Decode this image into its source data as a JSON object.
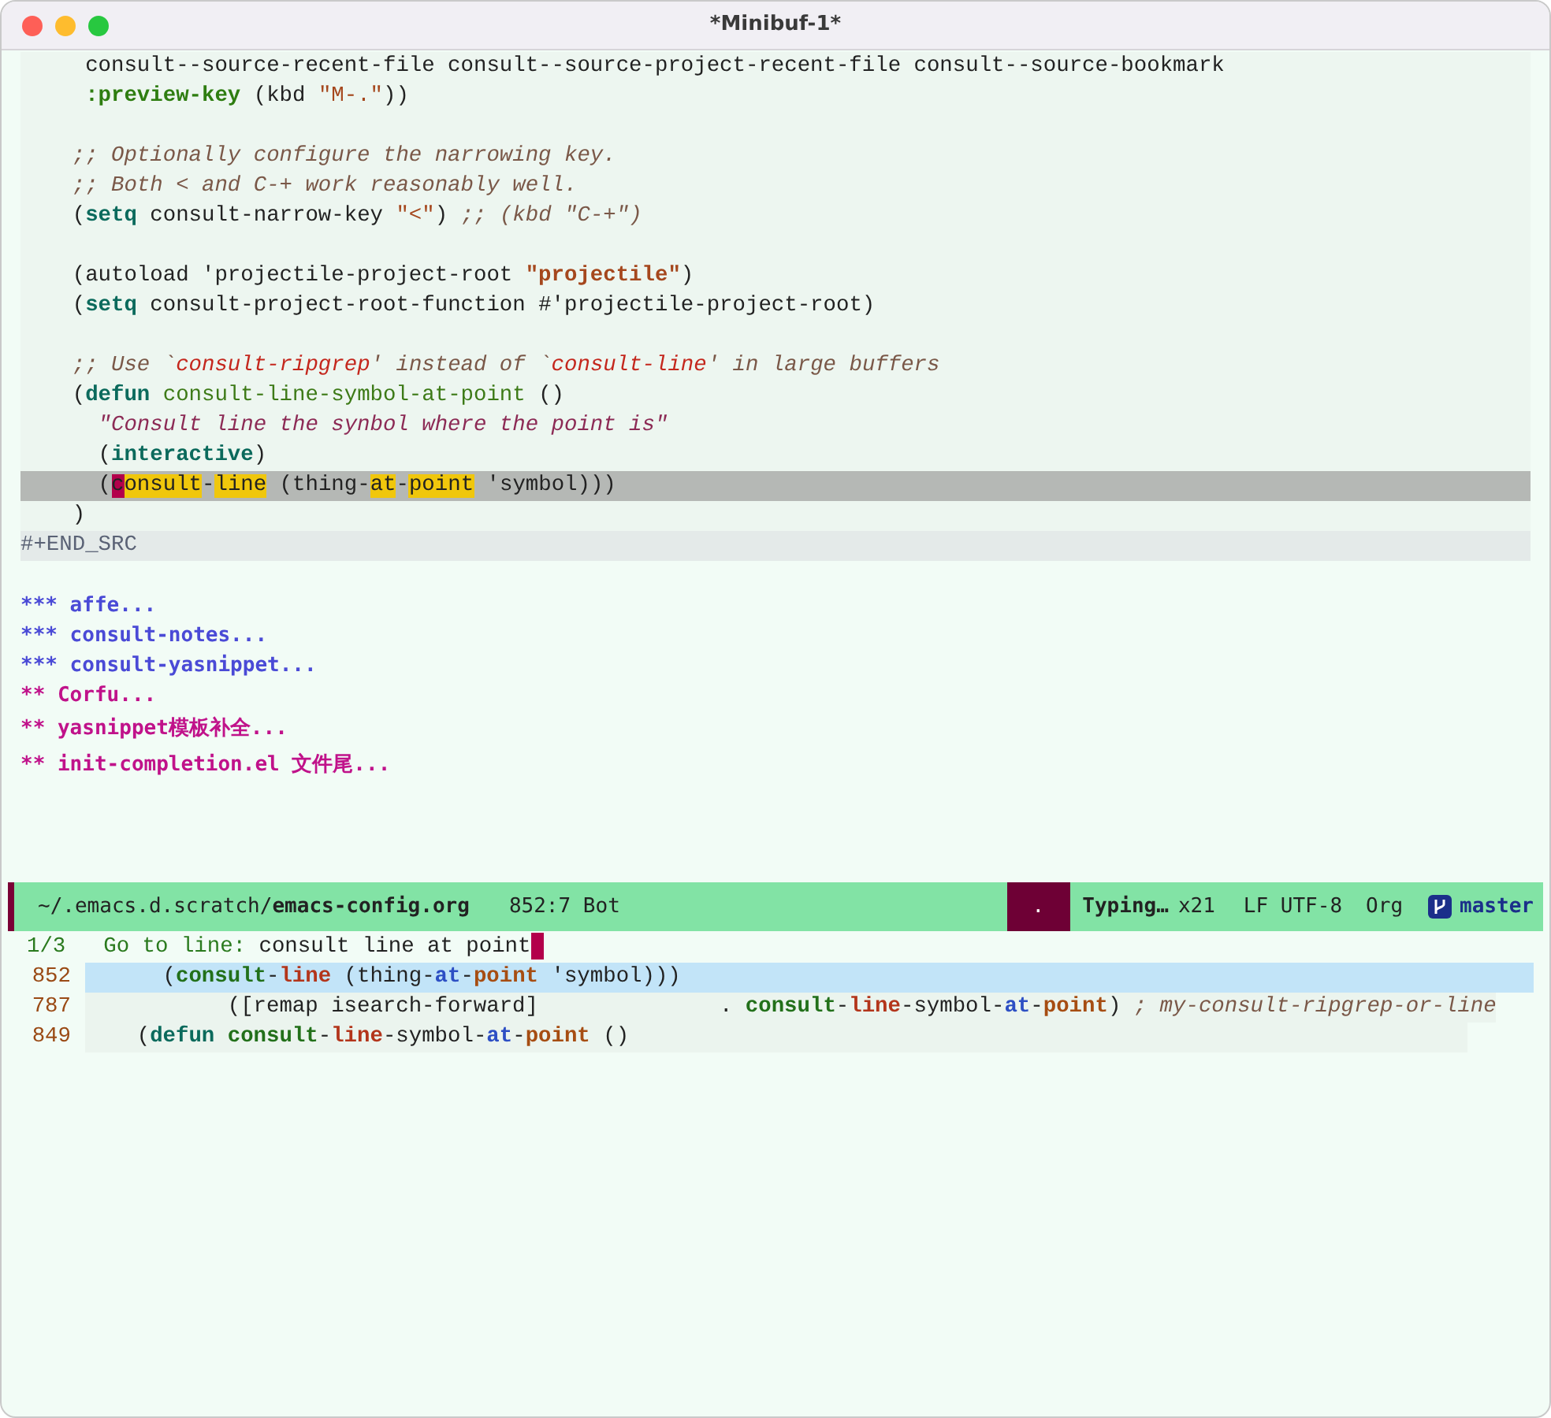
{
  "window": {
    "title": "*Minibuf-1*"
  },
  "buffer": {
    "lines": [
      {
        "kind": "src",
        "segments": [
          {
            "text": "     consult--source-recent-file consult--source-project-recent-file consult--source-bookmark",
            "kind": "plain"
          }
        ]
      },
      {
        "kind": "src",
        "segments": [
          {
            "text": "     :preview-key",
            "kind": "builtin"
          },
          {
            "text": " (kbd ",
            "kind": "plain"
          },
          {
            "text": "\"M-.\"",
            "kind": "str"
          },
          {
            "text": "))",
            "kind": "plain"
          }
        ]
      },
      {
        "kind": "src-blank"
      },
      {
        "kind": "src",
        "segments": [
          {
            "text": "    ;; Optionally configure the narrowing key.",
            "kind": "comment"
          }
        ]
      },
      {
        "kind": "src",
        "segments": [
          {
            "text": "    ;; Both < and C-+ work reasonably well.",
            "kind": "comment"
          }
        ]
      },
      {
        "kind": "src",
        "segments": [
          {
            "text": "    (",
            "kind": "plain"
          },
          {
            "text": "setq",
            "kind": "keyword"
          },
          {
            "text": " consult-narrow-key ",
            "kind": "plain"
          },
          {
            "text": "\"<\"",
            "kind": "str"
          },
          {
            "text": ") ",
            "kind": "plain"
          },
          {
            "text": ";; (kbd \"C-+\")",
            "kind": "comment"
          }
        ]
      },
      {
        "kind": "src-blank"
      },
      {
        "kind": "src",
        "segments": [
          {
            "text": "    (autoload 'projectile-project-root ",
            "kind": "plain"
          },
          {
            "text": "\"projectile\"",
            "kind": "str-bold"
          },
          {
            "text": ")",
            "kind": "plain"
          }
        ]
      },
      {
        "kind": "src",
        "segments": [
          {
            "text": "    (",
            "kind": "plain"
          },
          {
            "text": "setq",
            "kind": "keyword"
          },
          {
            "text": " consult-project-root-function #'projectile-project-root)",
            "kind": "plain"
          }
        ]
      },
      {
        "kind": "src-blank"
      },
      {
        "kind": "src",
        "segments": [
          {
            "text": "    ;; Use `",
            "kind": "comment"
          },
          {
            "text": "consult-ripgrep",
            "kind": "comment-ref"
          },
          {
            "text": "' instead of `",
            "kind": "comment"
          },
          {
            "text": "consult-line",
            "kind": "comment-ref"
          },
          {
            "text": "' in large buffers",
            "kind": "comment"
          }
        ]
      },
      {
        "kind": "src",
        "segments": [
          {
            "text": "    (",
            "kind": "plain"
          },
          {
            "text": "defun",
            "kind": "keyword"
          },
          {
            "text": " consult-line-symbol-at-point",
            "kind": "function"
          },
          {
            "text": " ()",
            "kind": "plain"
          }
        ]
      },
      {
        "kind": "src",
        "segments": [
          {
            "text": "      \"Consult line the synbol where the point is\"",
            "kind": "doc"
          }
        ]
      },
      {
        "kind": "src",
        "segments": [
          {
            "text": "      (",
            "kind": "plain"
          },
          {
            "text": "interactive",
            "kind": "keyword"
          },
          {
            "text": ")",
            "kind": "plain"
          }
        ]
      },
      {
        "kind": "current",
        "segments": [
          {
            "text": "      (",
            "kind": "plain"
          },
          {
            "text": "c",
            "kind": "cursor"
          },
          {
            "text": "onsult",
            "kind": "match"
          },
          {
            "text": "-",
            "kind": "plain"
          },
          {
            "text": "line",
            "kind": "match"
          },
          {
            "text": " (thing-",
            "kind": "plain"
          },
          {
            "text": "at",
            "kind": "match"
          },
          {
            "text": "-",
            "kind": "plain"
          },
          {
            "text": "point",
            "kind": "match"
          },
          {
            "text": " 'symbol)))",
            "kind": "plain"
          }
        ]
      },
      {
        "kind": "src",
        "segments": [
          {
            "text": "    )",
            "kind": "plain"
          }
        ]
      },
      {
        "kind": "src-end",
        "segments": [
          {
            "text": "#+END_SRC",
            "kind": "meta"
          }
        ]
      },
      {
        "kind": "blank"
      },
      {
        "kind": "heading",
        "segments": [
          {
            "text": "*** affe...",
            "kind": "h3"
          }
        ]
      },
      {
        "kind": "heading",
        "segments": [
          {
            "text": "*** consult-notes...",
            "kind": "h3"
          }
        ]
      },
      {
        "kind": "heading",
        "segments": [
          {
            "text": "*** consult-yasnippet...",
            "kind": "h3"
          }
        ]
      },
      {
        "kind": "heading",
        "segments": [
          {
            "text": "** Corfu...",
            "kind": "h2"
          }
        ]
      },
      {
        "kind": "heading",
        "segments": [
          {
            "text": "** yasnippet模板补全...",
            "kind": "h2"
          }
        ]
      },
      {
        "kind": "heading",
        "segments": [
          {
            "text": "** init-completion.el 文件尾...",
            "kind": "h2"
          }
        ]
      }
    ]
  },
  "mode_line": {
    "path": "~/.emacs.d.scratch/",
    "file": "emacs-config.org",
    "position": "852:7 Bot",
    "indicator": ".",
    "state": "Typing…",
    "count": "x21",
    "encoding": "LF UTF-8",
    "mode": "Org",
    "branch": "master"
  },
  "minibuffer": {
    "count": "1/3",
    "prompt": "Go to line: ",
    "input": "consult line at point",
    "candidates": [
      {
        "line_number": "852",
        "selected": true,
        "segments": [
          {
            "text": "      (",
            "kind": "plain"
          },
          {
            "text": "consult",
            "kind": "m1"
          },
          {
            "text": "-",
            "kind": "plain"
          },
          {
            "text": "line",
            "kind": "m2"
          },
          {
            "text": " (thing-",
            "kind": "plain"
          },
          {
            "text": "at",
            "kind": "m3"
          },
          {
            "text": "-",
            "kind": "plain"
          },
          {
            "text": "point",
            "kind": "m4"
          },
          {
            "text": " 'symbol)))",
            "kind": "plain"
          }
        ]
      },
      {
        "line_number": "787",
        "selected": false,
        "segments": [
          {
            "text": "           ([remap isearch-forward]              . ",
            "kind": "plain"
          },
          {
            "text": "consult",
            "kind": "m1"
          },
          {
            "text": "-",
            "kind": "plain"
          },
          {
            "text": "line",
            "kind": "m2"
          },
          {
            "text": "-symbol-",
            "kind": "plain"
          },
          {
            "text": "at",
            "kind": "m3"
          },
          {
            "text": "-",
            "kind": "plain"
          },
          {
            "text": "point",
            "kind": "m4"
          },
          {
            "text": ") ",
            "kind": "plain"
          },
          {
            "text": "; my-consult-ripgrep-or-line",
            "kind": "comment"
          }
        ]
      },
      {
        "line_number": "849",
        "selected": false,
        "segments": [
          {
            "text": "    (",
            "kind": "plain"
          },
          {
            "text": "defun",
            "kind": "keyword"
          },
          {
            "text": " consult",
            "kind": "m1"
          },
          {
            "text": "-",
            "kind": "plain"
          },
          {
            "text": "line",
            "kind": "m2"
          },
          {
            "text": "-symbol-",
            "kind": "plain"
          },
          {
            "text": "at",
            "kind": "m3"
          },
          {
            "text": "-",
            "kind": "plain"
          },
          {
            "text": "point",
            "kind": "m4"
          },
          {
            "text": " ()",
            "kind": "plain"
          }
        ]
      }
    ]
  }
}
